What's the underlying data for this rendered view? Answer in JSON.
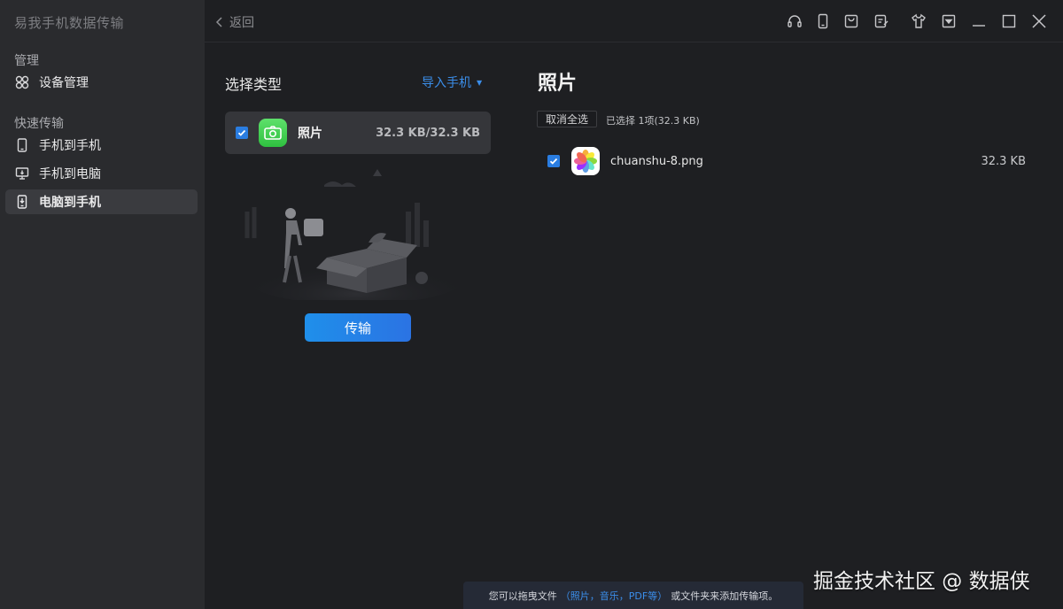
{
  "app": {
    "title": "易我手机数据传输"
  },
  "sidebar": {
    "section_manage": "管理",
    "device_manage": "设备管理",
    "section_quick": "快速传输",
    "items": [
      {
        "label": "手机到手机",
        "icon": "phone-icon"
      },
      {
        "label": "手机到电脑",
        "icon": "monitor-icon"
      },
      {
        "label": "电脑到手机",
        "icon": "phone-import-icon"
      }
    ],
    "active_index": 2
  },
  "topbar": {
    "back_label": "返回",
    "icons": [
      "headset-icon",
      "phone-icon",
      "bag-icon",
      "notes-icon",
      "shirt-icon",
      "dropdown-icon",
      "minimize-icon",
      "maximize-icon",
      "close-icon"
    ]
  },
  "left": {
    "select_type": "选择类型",
    "import_label": "导入手机",
    "card": {
      "label": "照片",
      "size": "32.3 KB/32.3 KB",
      "checked": true
    },
    "transfer_label": "传输"
  },
  "right": {
    "title": "照片",
    "deselect_label": "取消全选",
    "selected_info": "已选择 1项(32.3 KB)",
    "files": [
      {
        "name": "chuanshu-8.png",
        "size": "32.3 KB",
        "checked": true
      }
    ]
  },
  "footer": {
    "hint_prefix": "您可以拖曳文件",
    "hint_types": "（照片，音乐，PDF等）",
    "hint_suffix": "或文件夹来添加传输项。"
  },
  "watermark": "掘金技术社区 @ 数据侠",
  "colors": {
    "accent": "#2a7de1",
    "link": "#3b8eea",
    "sidebar": "#2a2b2e",
    "background": "#1e1f22"
  }
}
